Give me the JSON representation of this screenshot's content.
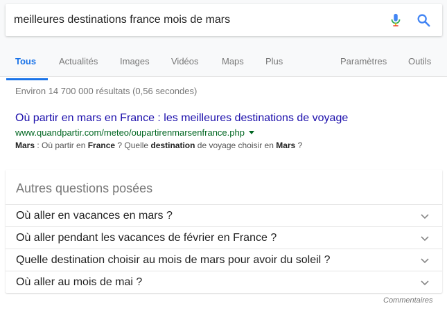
{
  "search": {
    "query": "meilleures destinations france mois de mars"
  },
  "tabs": [
    {
      "label": "Tous",
      "active": true
    },
    {
      "label": "Actualités"
    },
    {
      "label": "Images"
    },
    {
      "label": "Vidéos"
    },
    {
      "label": "Maps"
    },
    {
      "label": "Plus"
    },
    {
      "label": "Paramètres"
    },
    {
      "label": "Outils"
    }
  ],
  "result_stats": "Environ 14 700 000 résultats (0,56 secondes)",
  "result": {
    "title": "Où partir en mars en France : les meilleures destinations de voyage",
    "url": "www.quandpartir.com/meteo/oupartirenmarsenfrance.php",
    "snippet": [
      {
        "text": "Mars",
        "bold": true
      },
      {
        "text": " : Où partir en ",
        "bold": false
      },
      {
        "text": "France",
        "bold": true
      },
      {
        "text": " ? Quelle ",
        "bold": false
      },
      {
        "text": "destination",
        "bold": true
      },
      {
        "text": " de voyage choisir en ",
        "bold": false
      },
      {
        "text": "Mars",
        "bold": true
      },
      {
        "text": " ?",
        "bold": false
      }
    ]
  },
  "people_also_ask": {
    "title": "Autres questions posées",
    "questions": [
      "Où aller en vacances en mars ?",
      "Où aller pendant les vacances de février en France ?",
      "Quelle destination choisir au mois de mars pour avoir du soleil ?",
      "Où aller au mois de mai ?"
    ]
  },
  "feedback_label": "Commentaires",
  "colors": {
    "accent": "#1a73e8",
    "link": "#1a0dab",
    "url_green": "#006621",
    "muted": "#777777"
  }
}
